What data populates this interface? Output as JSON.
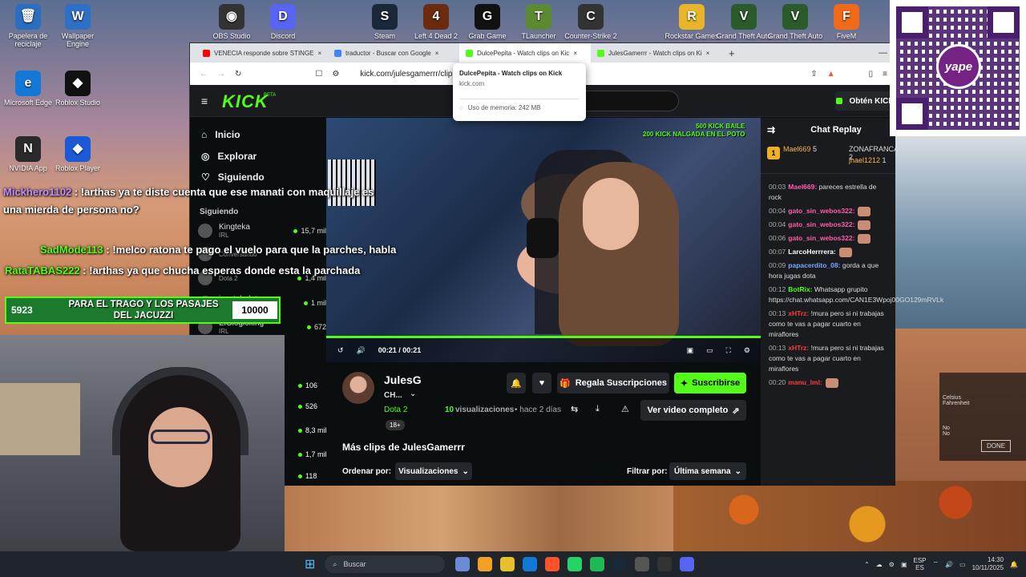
{
  "desktop": {
    "icons": [
      {
        "label": "Papelera de reciclaje",
        "glyph": "🗑"
      },
      {
        "label": "Wallpaper Engine",
        "glyph": "W"
      },
      {
        "label": "OBS Studio",
        "glyph": "◉"
      },
      {
        "label": "Discord",
        "glyph": "D"
      },
      {
        "label": "Steam",
        "glyph": "S"
      },
      {
        "label": "Left 4 Dead 2",
        "glyph": "4"
      },
      {
        "label": "Grab Game",
        "glyph": "G"
      },
      {
        "label": "TLauncher",
        "glyph": "T"
      },
      {
        "label": "Counter-Strike 2",
        "glyph": "C"
      },
      {
        "label": "Rockstar Games",
        "glyph": "R"
      },
      {
        "label": "Grand Theft Auto",
        "glyph": "V"
      },
      {
        "label": "Grand Theft Auto",
        "glyph": "V"
      },
      {
        "label": "FiveM",
        "glyph": "F"
      },
      {
        "label": "Microsoft Edge",
        "glyph": "e"
      },
      {
        "label": "Roblox Studio",
        "glyph": "◆"
      },
      {
        "label": "NVIDIA App",
        "glyph": "N"
      },
      {
        "label": "Roblox Player",
        "glyph": "◆"
      }
    ]
  },
  "browser": {
    "tabs": [
      {
        "label": "VENECIA responde sobre STINGE",
        "color": "#ff0000"
      },
      {
        "label": "traductor - Buscar con Google",
        "color": "#4285f4"
      },
      {
        "label": "DulcePepita - Watch clips on Kic",
        "color": "#53fc18"
      },
      {
        "label": "JulesGamerrr - Watch clips on Ki",
        "color": "#53fc18"
      }
    ],
    "new_tab": "+",
    "url": "kick.com/julesgamerrr/clips/clip_",
    "tooltip": {
      "title": "DulcePepita - Watch clips on Kick",
      "domain": "kick.com",
      "memory": "Uso de memoria: 242 MB"
    }
  },
  "kick": {
    "logo": "KICK",
    "beta": "BETA",
    "get_kick": "Obtén KICK",
    "nav": [
      {
        "label": "Inicio",
        "icon": "⌂"
      },
      {
        "label": "Explorar",
        "icon": "◎"
      },
      {
        "label": "Siguiendo",
        "icon": "♡"
      }
    ],
    "following_title": "Siguiendo",
    "following": [
      {
        "name": "Kingteka",
        "sub": "IRL",
        "count": "15,7 mil"
      },
      {
        "name": "",
        "sub": "Conversando",
        "count": ""
      },
      {
        "name": "",
        "sub": "Dota 2",
        "count": "1,4 mil"
      },
      {
        "name": "ieostyledota",
        "sub": "Dota 2",
        "count": "1 mil"
      },
      {
        "name": "ElGlogloking",
        "sub": "IRL",
        "count": "672"
      }
    ],
    "more_counts": [
      "106",
      "526",
      "8,3 mil",
      "1,7 mil",
      "118"
    ],
    "video": {
      "overlay_top": "500 KICK BAILE",
      "overlay_bottom": "200 KICK NALGADA EN EL POTO",
      "time": "00:21 / 00:21"
    },
    "channel": {
      "name": "JulesG",
      "sub": "CH...",
      "game": "Dota 2",
      "views_count": "10",
      "views_label": "visualizaciones",
      "ago": "• hace 2 días",
      "age": "18+",
      "gift_label": "Regala Suscripciones",
      "subscribe_label": "Suscribirse",
      "full_video_label": "Ver video completo"
    },
    "more_clips": "Más clips de JulesGamerrr",
    "order_label": "Ordenar por:",
    "order_value": "Visualizaciones",
    "filter_label": "Filtrar por:",
    "filter_value": "Última semana",
    "chat": {
      "title": "Chat Replay",
      "leaders": [
        {
          "name": "Mael669",
          "value": "5"
        },
        {
          "name": "ZONAFRANCA",
          "value": "2"
        },
        {
          "name": "jhael1212",
          "value": "1"
        }
      ],
      "messages": [
        {
          "time": "00:03",
          "user": "Mael669",
          "color": "#ff5ea8",
          "text": "pareces estrella de rock"
        },
        {
          "time": "00:04",
          "user": "gato_sin_webos322",
          "color": "#ff5ea8",
          "text": ""
        },
        {
          "time": "00:04",
          "user": "gato_sin_webos322",
          "color": "#ff5ea8",
          "text": ""
        },
        {
          "time": "00:06",
          "user": "gato_sin_webos322",
          "color": "#ff5ea8",
          "text": ""
        },
        {
          "time": "00:07",
          "user": "LarcoHerrrera",
          "color": "#ffffff",
          "text": ""
        },
        {
          "time": "00:09",
          "user": "papacerdito_08",
          "color": "#7aa7ff",
          "text": "gorda a que hora jugas dota"
        },
        {
          "time": "00:12",
          "user": "BotRix",
          "color": "#53fc18",
          "text": "Whatsapp grupito https://chat.whatsapp.com/CAN1E3Wpoj00GO129mRVLk"
        },
        {
          "time": "00:13",
          "user": "xHTrz",
          "color": "#ff3b3b",
          "text": "!mura pero si ni trabajas como te vas a pagar cuarto en miraflores"
        },
        {
          "time": "00:13",
          "user": "xHTrz",
          "color": "#ff3b3b",
          "text": "!mura pero si ni trabajas como te vas a pagar cuarto en miraflores"
        },
        {
          "time": "00:20",
          "user": "manu_lml",
          "color": "#ff3b3b",
          "text": ""
        }
      ]
    }
  },
  "stream_overlay": {
    "chat": [
      {
        "user": "Mickhero1102",
        "color": "#c78bff",
        "text": ": !arthas ya te diste cuenta que ese manati con maquillaje es"
      },
      {
        "user": "",
        "color": "#ffffff",
        "text": "una mierda de persona no?"
      },
      {
        "user": "SadMode113",
        "color": "#53fc18",
        "text": ": !melco ratona te pago el vuelo para que la parches, habla"
      },
      {
        "user": "RataTABAS222",
        "color": "#53fc18",
        "text": ": !arthas ya que chucha esperas donde esta la parchada"
      }
    ],
    "donation": {
      "left": "5923",
      "text": "PARA EL TRAGO Y LOS PASAJES DEL JACUZZI",
      "right": "10000"
    }
  },
  "qr": {
    "brand": "yape"
  },
  "weather_widget": {
    "c": "Celsius",
    "f": "Fahrenheit",
    "no": "No",
    "done": "DONE"
  },
  "taskbar": {
    "search": "Buscar",
    "lang": "ESP",
    "region": "ES",
    "time": "14:30",
    "date": "10/11/2025",
    "badges": [
      "85",
      "99+"
    ]
  }
}
